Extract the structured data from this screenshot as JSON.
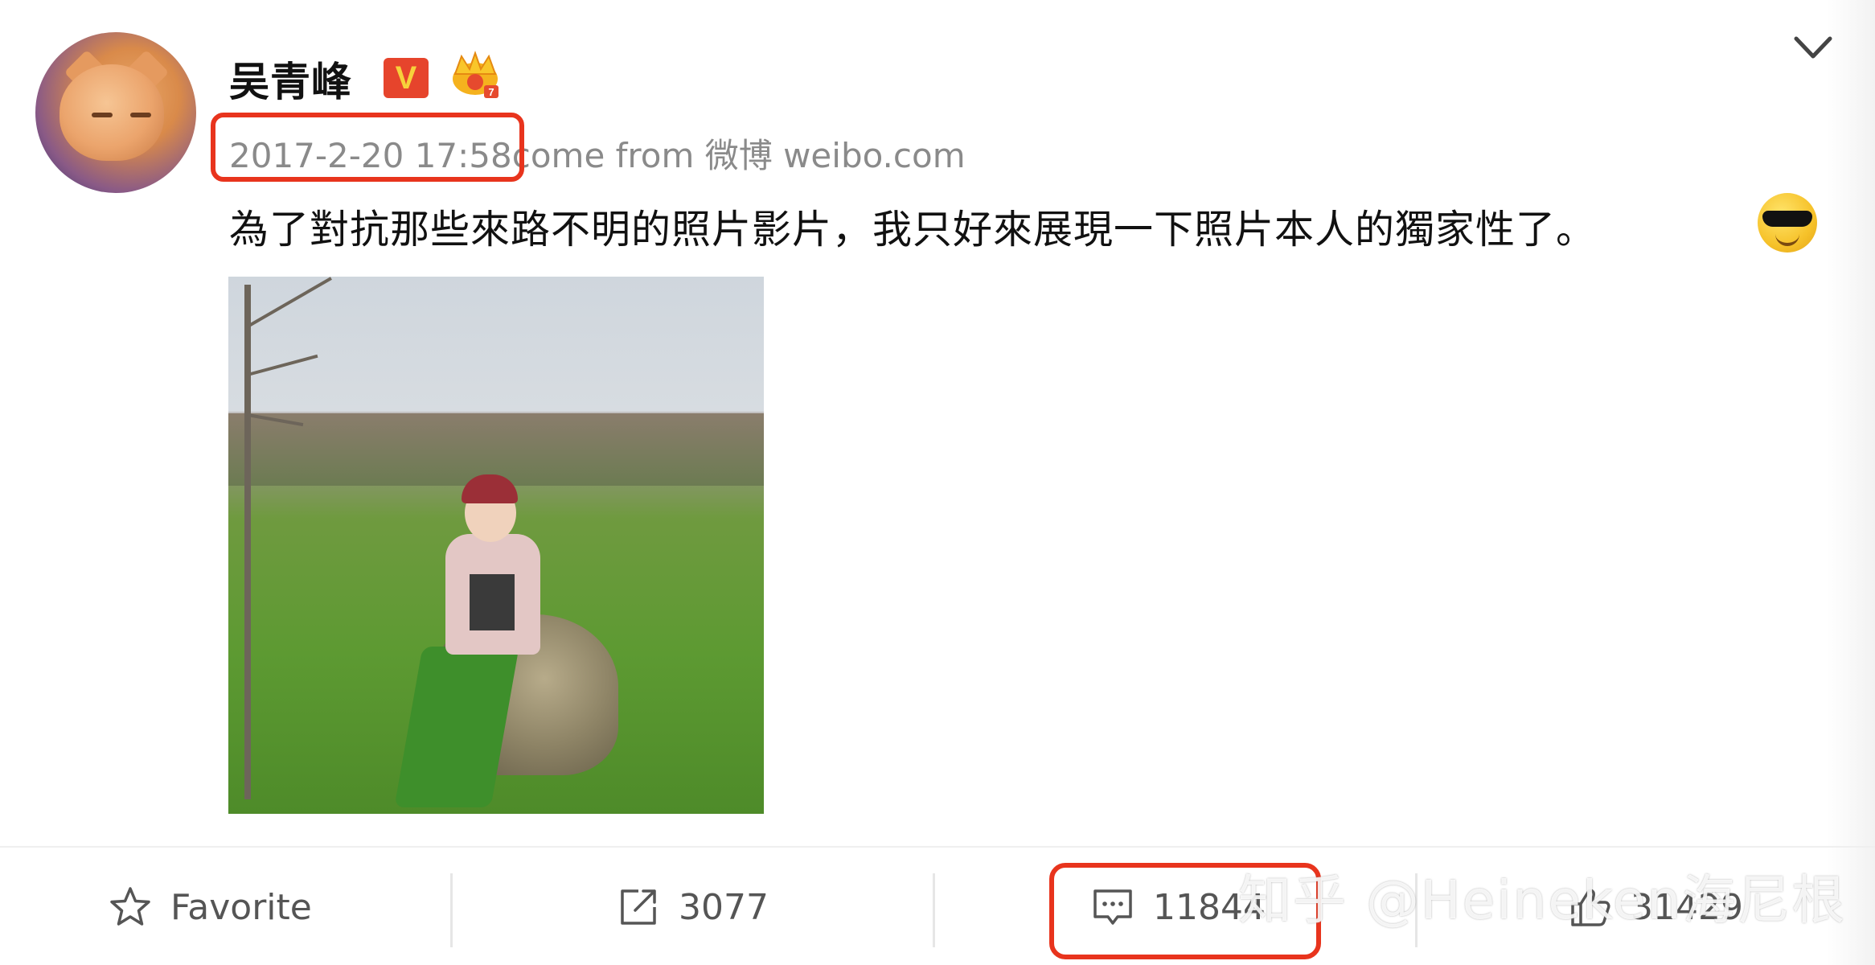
{
  "post": {
    "author": "吴青峰",
    "verified_badge": "V",
    "member_badge_icon": "crown-icon",
    "timestamp": "2017-2-20 17:58",
    "source": "come from 微博 weibo.com",
    "text": "為了對抗那些來路不明的照片影片，我只好來展現一下照片本人的獨家性了。",
    "emoji_icon": "sunglasses-emoji-icon"
  },
  "actions": {
    "favorite_label": "Favorite",
    "repost_count": "3077",
    "comment_count": "11844",
    "like_count": "31429"
  },
  "watermark": "知乎 @Heineken海尼根",
  "colors": {
    "highlight": "#e8341d",
    "verified_badge_bg": "#e6442c",
    "verified_badge_text": "#f7d13b"
  }
}
